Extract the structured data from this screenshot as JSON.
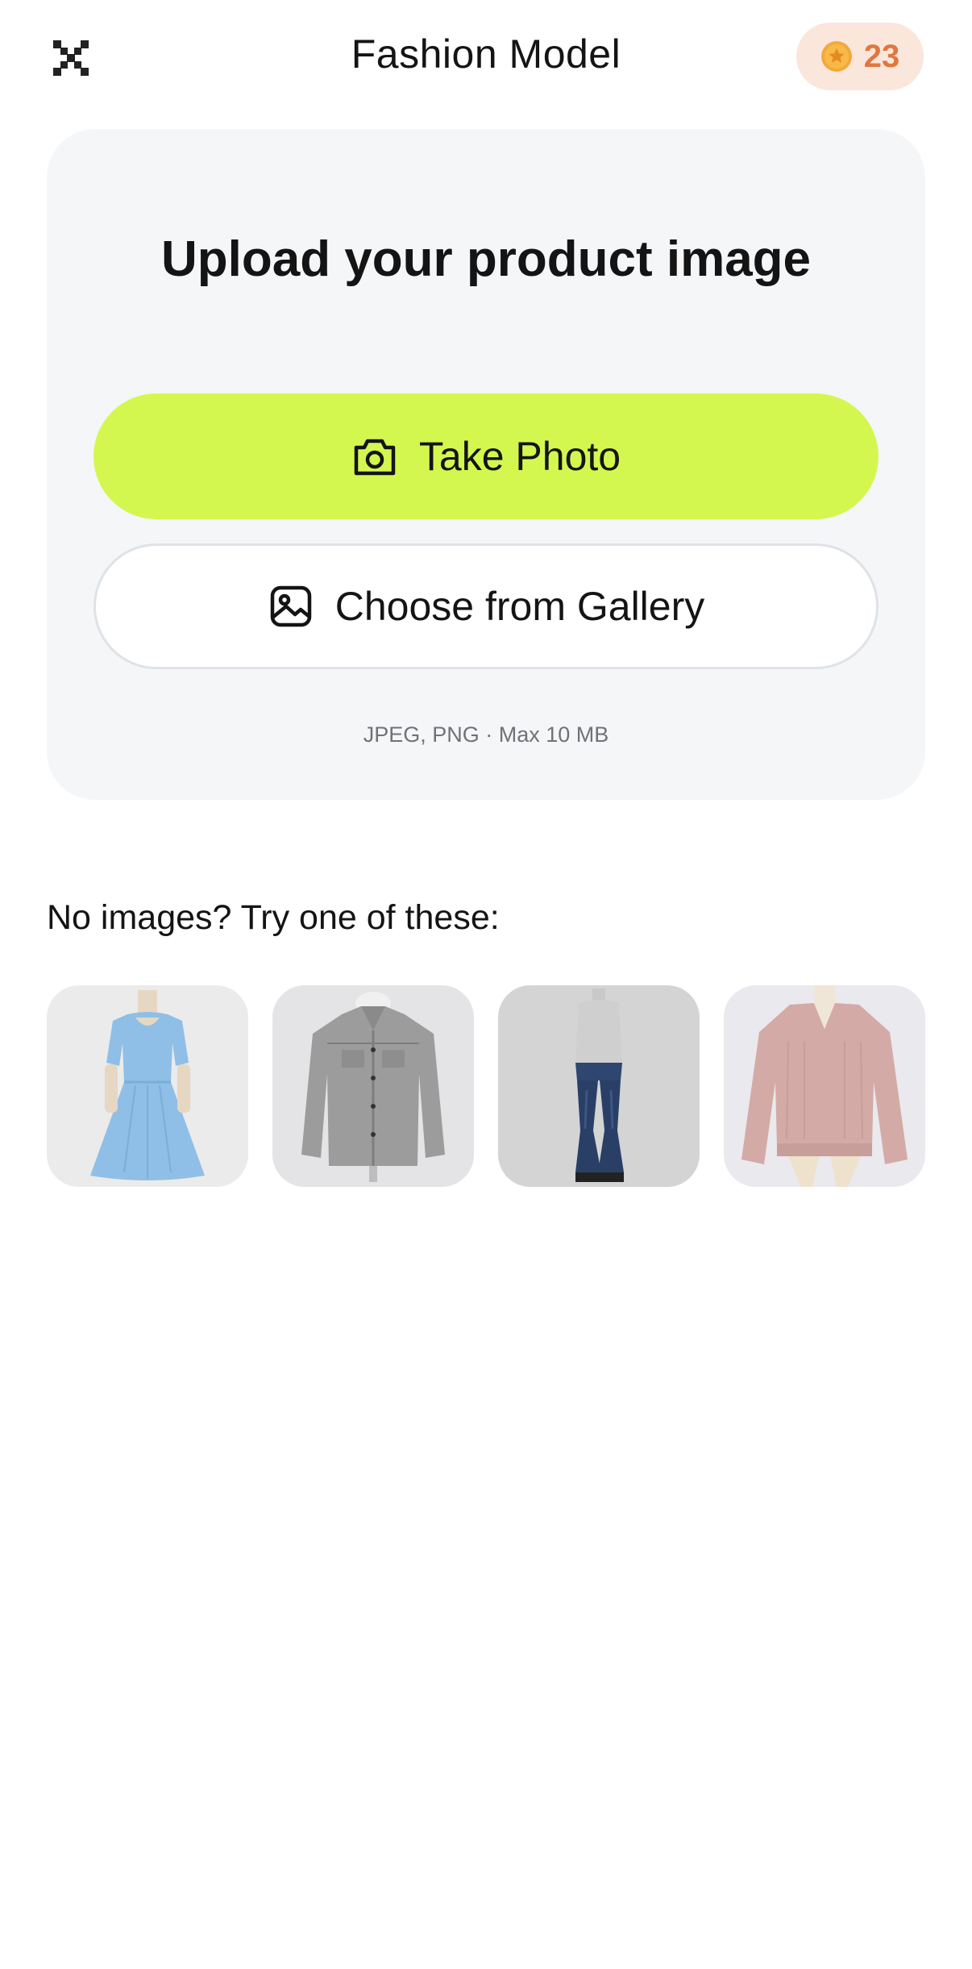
{
  "header": {
    "title": "Fashion Model",
    "close_icon": "close-icon",
    "coins": {
      "icon": "star-coin-icon",
      "count": "23",
      "color": "#e0773f",
      "background": "#fbe6dc"
    }
  },
  "upload": {
    "title": "Upload your product image",
    "take_photo": {
      "label": "Take Photo",
      "icon": "camera-icon",
      "color": "#d4f74f"
    },
    "gallery": {
      "label": "Choose from Gallery",
      "icon": "image-icon"
    },
    "hint": "JPEG, PNG · Max 10 MB"
  },
  "samples": {
    "heading": "No images? Try one of these:",
    "items": [
      {
        "name": "blue-dress"
      },
      {
        "name": "grey-shirt"
      },
      {
        "name": "flare-jeans"
      },
      {
        "name": "pink-sweater"
      }
    ]
  }
}
